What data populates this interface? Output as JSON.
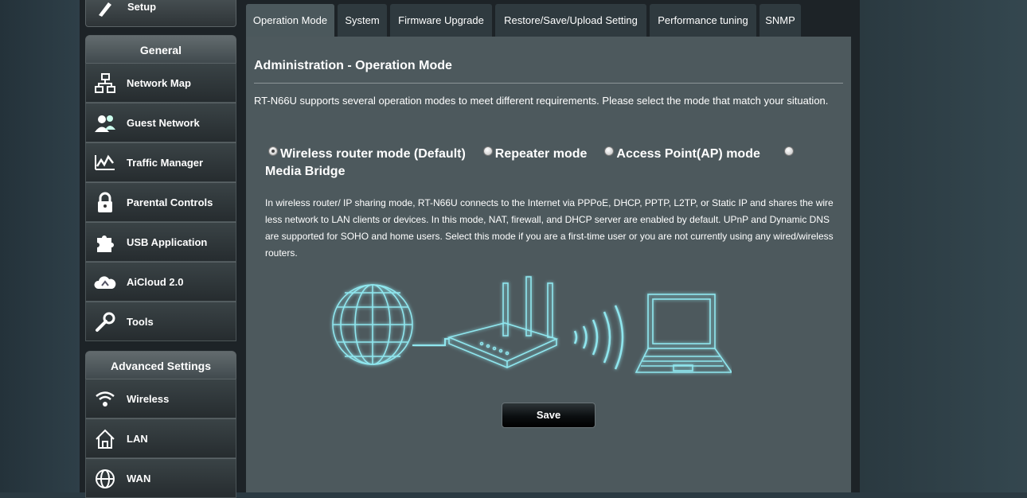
{
  "sidebar": {
    "setup_label": "Setup",
    "general_header": "General",
    "general_items": [
      {
        "label": "Network Map",
        "icon": "network-map-icon"
      },
      {
        "label": "Guest Network",
        "icon": "guest-network-icon"
      },
      {
        "label": "Traffic Manager",
        "icon": "traffic-manager-icon"
      },
      {
        "label": "Parental Controls",
        "icon": "parental-controls-icon"
      },
      {
        "label": "USB Application",
        "icon": "usb-application-icon"
      },
      {
        "label": "AiCloud 2.0",
        "icon": "aicloud-icon"
      },
      {
        "label": "Tools",
        "icon": "tools-icon"
      }
    ],
    "advanced_header": "Advanced Settings",
    "advanced_items": [
      {
        "label": "Wireless",
        "icon": "wireless-icon"
      },
      {
        "label": "LAN",
        "icon": "lan-icon"
      },
      {
        "label": "WAN",
        "icon": "wan-icon"
      }
    ]
  },
  "tabs": [
    {
      "label": "Operation Mode",
      "active": true
    },
    {
      "label": "System"
    },
    {
      "label": "Firmware Upgrade"
    },
    {
      "label": "Restore/Save/Upload Setting"
    },
    {
      "label": "Performance tuning"
    },
    {
      "label": "SNMP"
    }
  ],
  "main": {
    "title": "Administration - Operation Mode",
    "description": "RT-N66U supports several operation modes to meet different requirements. Please select the mode that match your situation.",
    "modes": [
      {
        "label": "Wireless router mode (Default)",
        "selected": true
      },
      {
        "label": "Repeater mode",
        "selected": false
      },
      {
        "label": "Access Point(AP) mode",
        "selected": false
      },
      {
        "label": "Media Bridge",
        "selected": false
      }
    ],
    "mode_description": "In wireless router/ IP sharing mode, RT-N66U connects to the Internet via PPPoE, DHCP, PPTP, L2TP, or Static IP and shares the wireless network to LAN clients or devices. In this mode, NAT, firewall, and DHCP server are enabled by default. UPnP and Dynamic DNS are supported for SOHO and home users. Select this mode if you are a first-time user or you are not currently using any wired/wireless routers.",
    "save_label": "Save"
  },
  "colors": {
    "accent_glow": "#7fe0e8",
    "content_bg": "#4d595d",
    "tab_active": "#4b585c"
  }
}
